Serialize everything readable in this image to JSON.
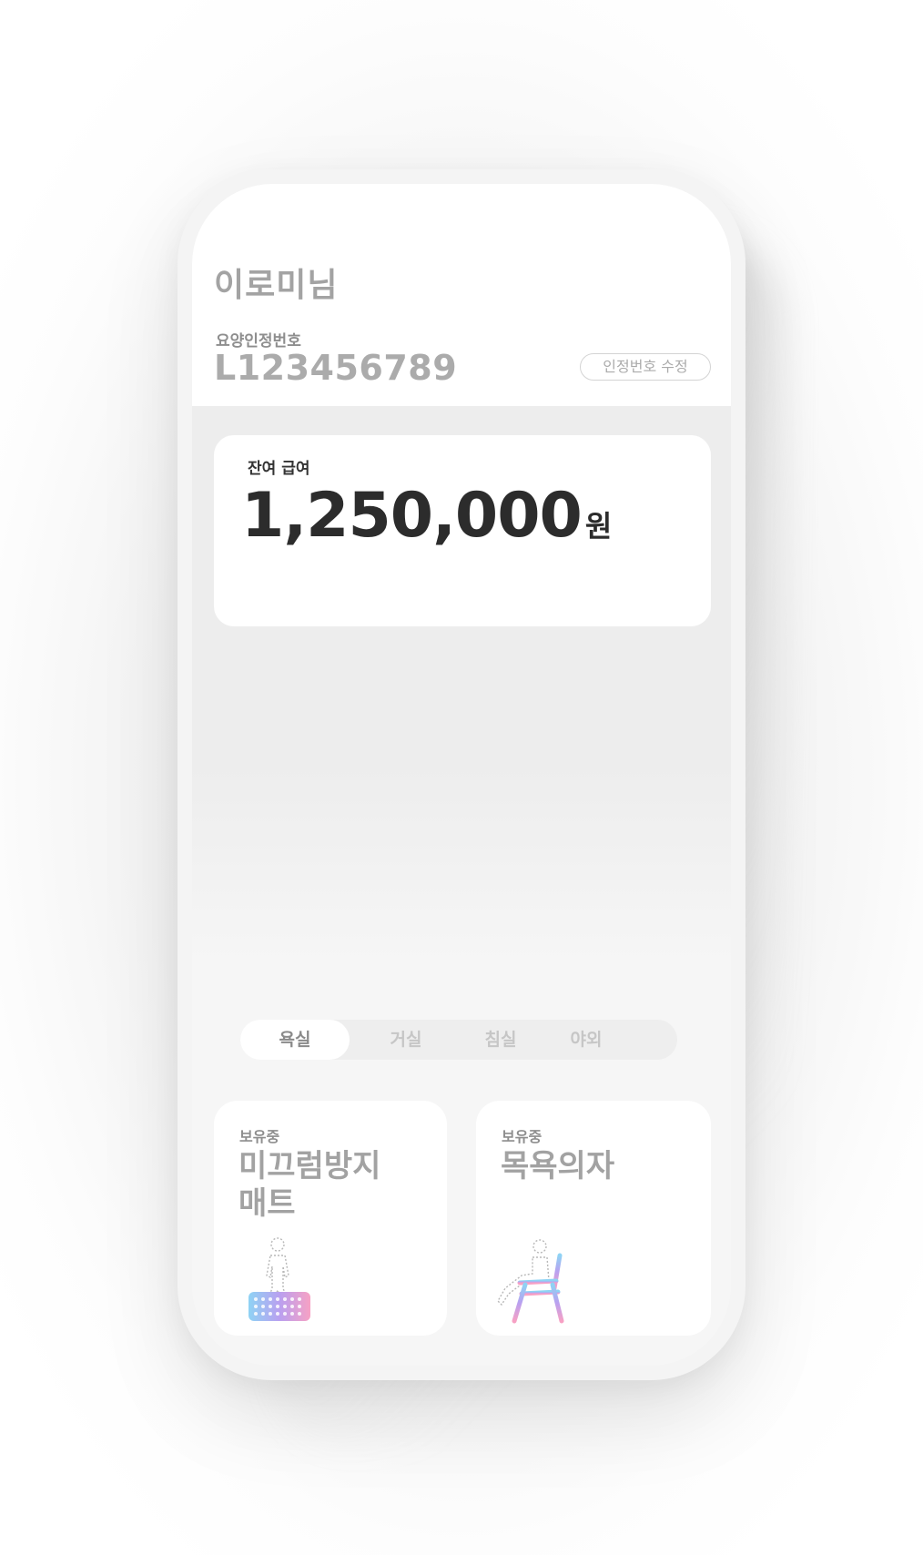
{
  "profile": {
    "name": "이로미님",
    "cert_label": "요양인정번호",
    "cert_number": "L123456789",
    "edit_button": "인정번호 수정"
  },
  "balance": {
    "label": "잔여 급여",
    "amount": "1,250,000",
    "unit": "원"
  },
  "tabs": {
    "items": [
      {
        "label": "욕실",
        "active": true
      },
      {
        "label": "거실",
        "active": false
      },
      {
        "label": "침실",
        "active": false
      },
      {
        "label": "야외",
        "active": false
      }
    ]
  },
  "items": [
    {
      "status": "보유중",
      "name": "미끄럼방지 매트",
      "icon": "anti-slip-mat-icon"
    },
    {
      "status": "보유중",
      "name": "목욕의자",
      "icon": "bath-chair-icon"
    }
  ],
  "colors": {
    "screen_background": "#ededed",
    "card_background": "#ffffff",
    "primary_text": "#2c2c2c",
    "muted_text": "#a3a3a3",
    "gradient_blue": "#8fd3f4",
    "gradient_purple": "#b9a0f0",
    "gradient_pink": "#f7a1c4"
  }
}
